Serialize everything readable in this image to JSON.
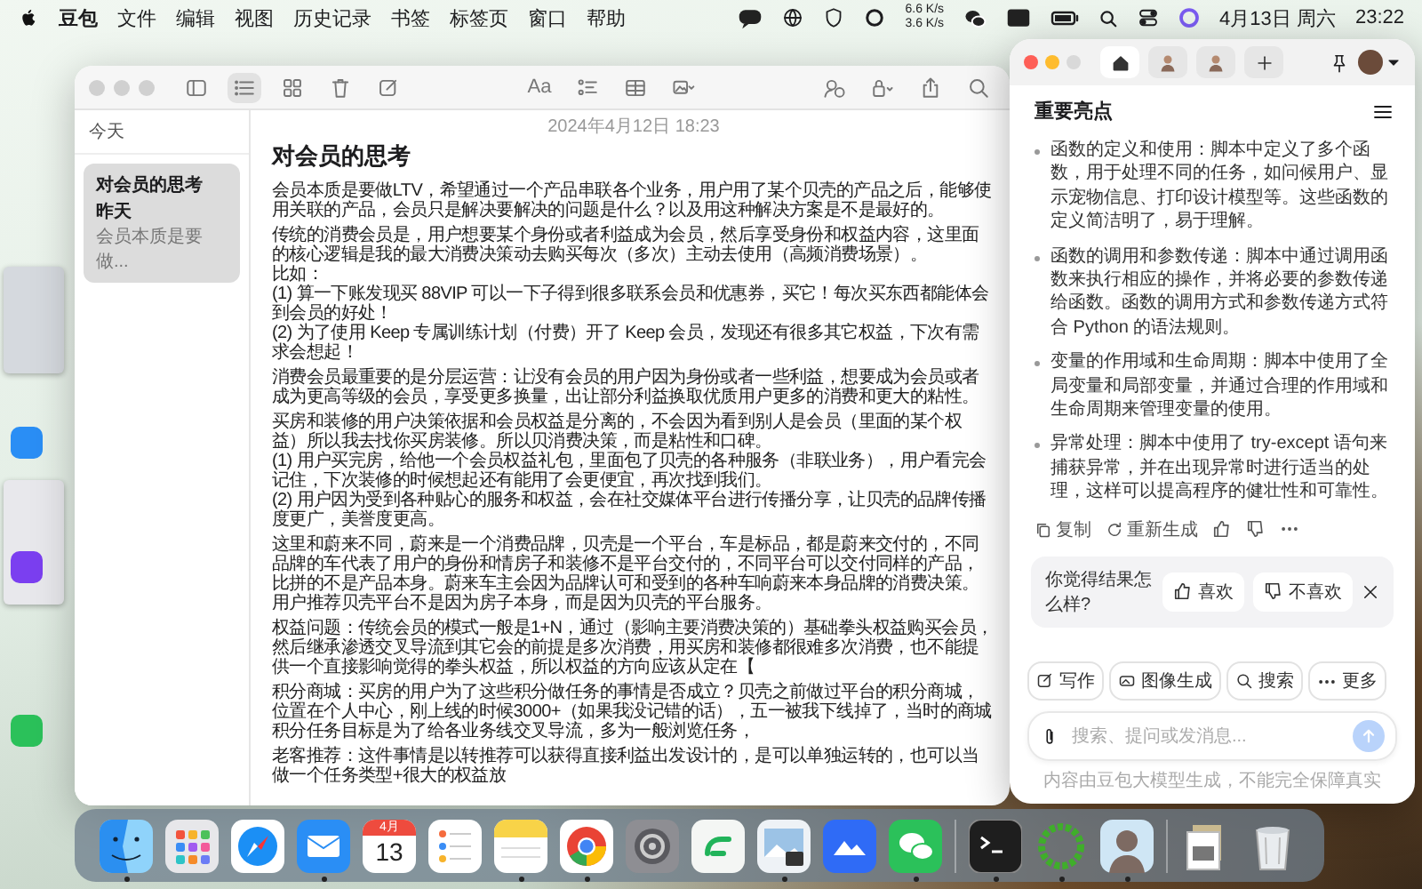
{
  "menu_bar": {
    "app_name": "豆包",
    "menus": [
      "文件",
      "编辑",
      "视图",
      "历史记录",
      "书签",
      "标签页",
      "窗口",
      "帮助"
    ],
    "net_up": "6.6 K/s",
    "net_down": "3.6 K/s",
    "date": "4月13日 周六",
    "time": "23:22"
  },
  "notes_window": {
    "toolbar": [
      {
        "kind": "sidebar"
      },
      {
        "kind": "list",
        "selected": true
      },
      {
        "kind": "gallery",
        "selected": false
      },
      {
        "kind": "trash"
      },
      {
        "kind": "compose"
      },
      {
        "kind": "format",
        "label": "Aa"
      },
      {
        "kind": "checklist"
      },
      {
        "kind": "table"
      },
      {
        "kind": "media"
      },
      {
        "kind": "collaborate"
      },
      {
        "kind": "lock"
      },
      {
        "kind": "share"
      },
      {
        "kind": "search"
      }
    ],
    "sidebar": {
      "section": "今天",
      "notes": [
        {
          "title": "对会员的思考",
          "date": "昨天",
          "preview": "会员本质是要做...",
          "selected": true
        }
      ]
    },
    "note": {
      "timestamp": "2024年4月12日 18:23",
      "title": "对会员的思考",
      "paragraphs": [
        [
          "会员本质是要做LTV，希望通过一个产品串联各个业务，用户用了某个贝壳的产品之后，能够使用关联的产品，会员只是解决要解决的问题是什么？以及用这种解决方案是不是最好的。"
        ],
        [
          "传统的消费会员是，用户想要某个身份或者利益成为会员，然后享受身份和权益内容，这里面的核心逻辑是我的最大消费决策动去购买每次（多次）主动去使用（高频消费场景）。",
          "比如：",
          "(1) 算一下账发现买 88VIP 可以一下子得到很多联系会员和优惠券，买它！每次买东西都能体会到会员的好处！",
          "(2) 为了使用 Keep 专属训练计划（付费）开了 Keep 会员，发现还有很多其它权益，下次有需求会想起！"
        ],
        [
          "消费会员最重要的是分层运营：让没有会员的用户因为身份或者一些利益，想要成为会员或者成为更高等级的会员，享受更多换量，出让部分利益换取优质用户更多的消费和更大的粘性。"
        ],
        [
          "买房和装修的用户决策依据和会员权益是分离的，不会因为看到别人是会员（里面的某个权益）所以我去找你买房装修。所以贝消费决策，而是粘性和口碑。",
          "(1) 用户买完房，给他一个会员权益礼包，里面包了贝壳的各种服务（非联业务），用户看完会记住，下次装修的时候想起还有能用了会更便宜，再次找到我们。",
          "(2) 用户因为受到各种贴心的服务和权益，会在社交媒体平台进行传播分享，让贝壳的品牌传播度更广，美誉度更高。"
        ],
        [
          "这里和蔚来不同，蔚来是一个消费品牌，贝壳是一个平台，车是标品，都是蔚来交付的，不同品牌的车代表了用户的身份和情房子和装修不是平台交付的，不同平台可以交付同样的产品，比拼的不是产品本身。蔚来车主会因为品牌认可和受到的各种车响蔚来本身品牌的消费决策。用户推荐贝壳平台不是因为房子本身，而是因为贝壳的平台服务。"
        ],
        [
          "权益问题：传统会员的模式一般是1+N，通过（影响主要消费决策的）基础拳头权益购买会员，然后继承渗透交叉导流到其它会的前提是多次消费，用买房和装修都很难多次消费，也不能提供一个直接影响觉得的拳头权益，所以权益的方向应该从定在【"
        ],
        [
          "积分商城：买房的用户为了这些积分做任务的事情是否成立？贝壳之前做过平台的积分商城，位置在个人中心，刚上线的时候3000+（如果我没记错的话），五一被我下线掉了，当时的商城积分任务目标是为了给各业务线交叉导流，多为一般浏览任务，"
        ],
        [
          "老客推荐：这件事情是以转推荐可以获得直接利益出发设计的，是可以单独运转的，也可以当做一个任务类型+很大的权益放"
        ]
      ]
    }
  },
  "assistant_panel": {
    "tabs": [
      {
        "kind": "home",
        "selected": true
      },
      {
        "kind": "avatar",
        "selected": false
      },
      {
        "kind": "avatar",
        "selected": false
      },
      {
        "kind": "new",
        "selected": false
      }
    ],
    "title": "重要亮点",
    "highlights": [
      "函数的定义和使用：脚本中定义了多个函数，用于处理不同的任务，如问候用户、显示宠物信息、打印设计模型等。这些函数的定义简洁明了，易于理解。",
      "函数的调用和参数传递：脚本中通过调用函数来执行相应的操作，并将必要的参数传递给函数。函数的调用方式和参数传递方式符合 Python 的语法规则。",
      "变量的作用域和生命周期：脚本中使用了全局变量和局部变量，并通过合理的作用域和生命周期来管理变量的使用。",
      "异常处理：脚本中使用了 try-except 语句来捕获异常，并在出现异常时进行适当的处理，这样可以提高程序的健壮性和可靠性。"
    ],
    "actions": [
      {
        "kind": "copy",
        "label": "复制"
      },
      {
        "kind": "regenerate",
        "label": "重新生成"
      },
      {
        "kind": "like"
      },
      {
        "kind": "dislike"
      },
      {
        "kind": "more"
      }
    ],
    "feedback": {
      "question": "你觉得结果怎么样?",
      "like": "喜欢",
      "dislike": "不喜欢"
    },
    "chips": [
      {
        "kind": "write",
        "label": "写作"
      },
      {
        "kind": "image",
        "label": "图像生成"
      },
      {
        "kind": "search",
        "label": "搜索"
      },
      {
        "kind": "more",
        "label": "更多"
      }
    ],
    "input": {
      "placeholder": "搜索、提问或发消息..."
    },
    "disclaimer": "内容由豆包大模型生成，不能完全保障真实"
  },
  "dock": {
    "items": [
      {
        "kind": "finder",
        "running": true
      },
      {
        "kind": "launchpad",
        "running": false
      },
      {
        "kind": "safari",
        "running": false
      },
      {
        "kind": "mail",
        "running": true
      },
      {
        "kind": "calendar",
        "month": "4月",
        "day": "13",
        "running": false
      },
      {
        "kind": "reminders",
        "running": false
      },
      {
        "kind": "notes",
        "running": true
      },
      {
        "kind": "chrome",
        "running": true
      },
      {
        "kind": "settings",
        "running": false
      },
      {
        "kind": "green_app",
        "running": false
      },
      {
        "kind": "preview",
        "running": true
      },
      {
        "kind": "lark",
        "running": false
      },
      {
        "kind": "wechat",
        "running": true
      },
      {
        "kind": "separator"
      },
      {
        "kind": "terminal",
        "running": true
      },
      {
        "kind": "ring",
        "running": true
      },
      {
        "kind": "avatar",
        "running": true
      },
      {
        "kind": "separator"
      },
      {
        "kind": "documents",
        "running": false
      },
      {
        "kind": "trash",
        "running": false
      }
    ]
  }
}
